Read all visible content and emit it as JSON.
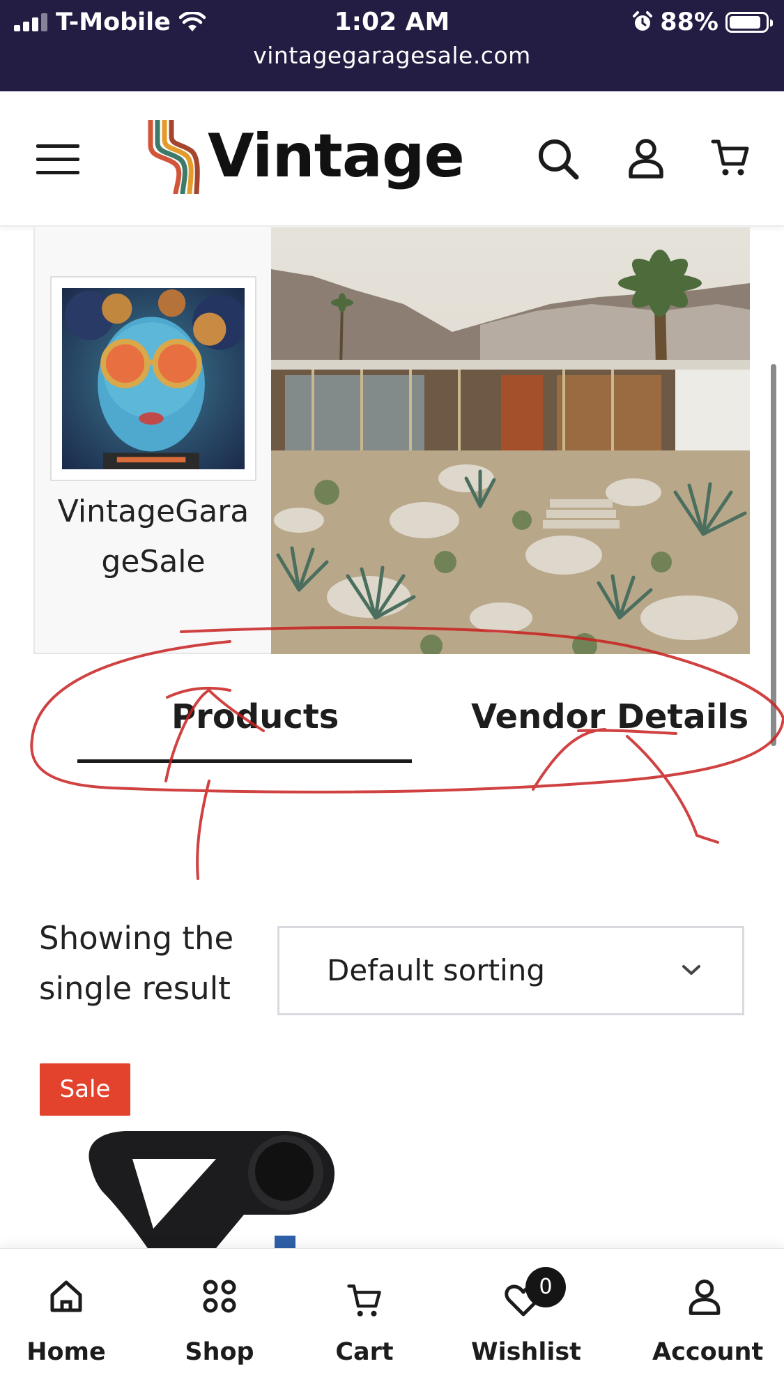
{
  "status_bar": {
    "carrier": "T-Mobile",
    "time": "1:02 AM",
    "battery": "88%",
    "battery_level": 0.88,
    "url": "vintagegaragesale.com"
  },
  "header": {
    "logo_text": "Vintage",
    "icons": [
      "menu-icon",
      "search-icon",
      "user-icon",
      "cart-icon"
    ]
  },
  "vendor": {
    "name_line1": "VintageGara",
    "name_line2": "geSale"
  },
  "tabs": {
    "products": "Products",
    "vendor_details": "Vendor Details",
    "active": "Products"
  },
  "results": {
    "line1": "Showing the",
    "line2": "single result"
  },
  "sorting": {
    "selected": "Default sorting"
  },
  "product": {
    "badge": "Sale"
  },
  "bottom_nav": {
    "home": "Home",
    "shop": "Shop",
    "cart": "Cart",
    "wishlist": "Wishlist",
    "wishlist_count": "0",
    "account": "Account"
  },
  "colors": {
    "status_bar_bg": "#231c43",
    "sale_badge": "#e3422d",
    "annotation": "#c82020"
  }
}
